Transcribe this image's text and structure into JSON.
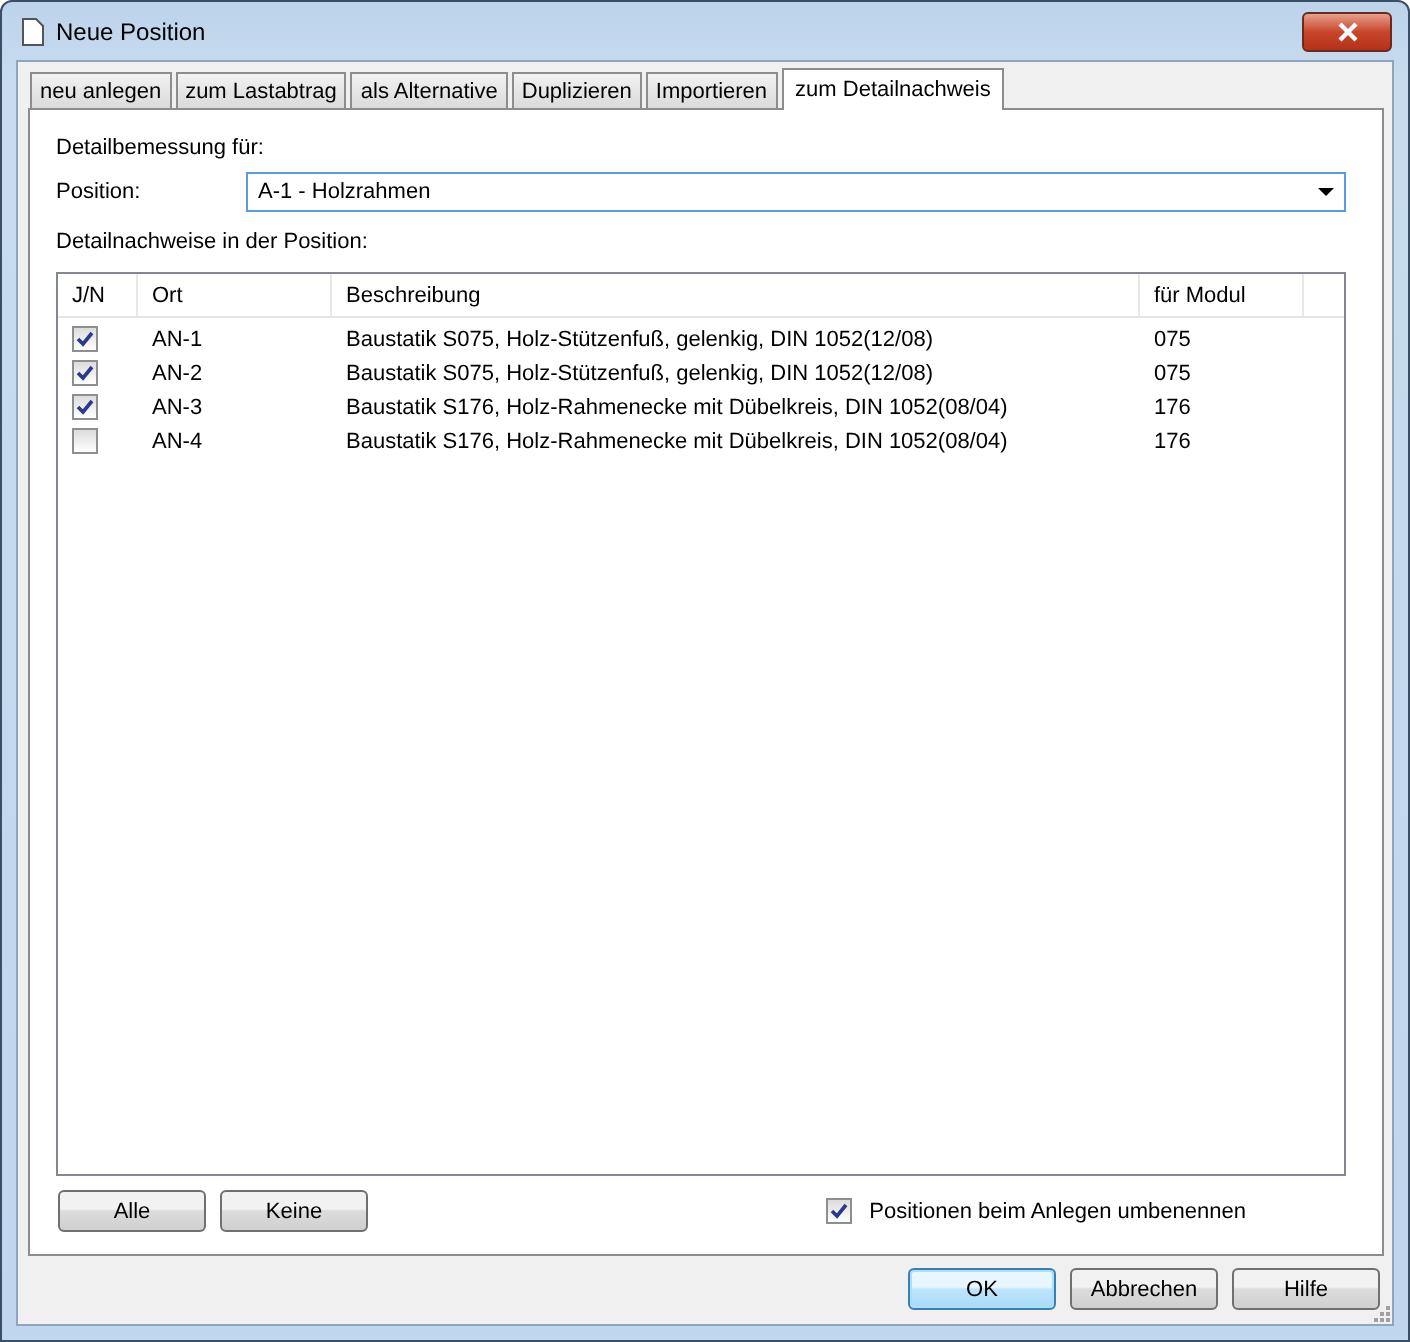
{
  "window": {
    "title": "Neue Position"
  },
  "tabs": [
    {
      "label": "neu anlegen",
      "selected": false
    },
    {
      "label": "zum Lastabtrag",
      "selected": false
    },
    {
      "label": "als Alternative",
      "selected": false
    },
    {
      "label": "Duplizieren",
      "selected": false
    },
    {
      "label": "Importieren",
      "selected": false
    },
    {
      "label": "zum Detailnachweis",
      "selected": true
    }
  ],
  "section_label": "Detailbemessung für:",
  "position": {
    "label": "Position:",
    "value": "A-1 - Holzrahmen"
  },
  "list_label": "Detailnachweise in der Position:",
  "table": {
    "columns": [
      "J/N",
      "Ort",
      "Beschreibung",
      "für Modul"
    ],
    "rows": [
      {
        "checked": true,
        "ort": "AN-1",
        "beschreibung": "Baustatik S075, Holz-Stützenfuß, gelenkig, DIN 1052(12/08)",
        "modul": "075"
      },
      {
        "checked": true,
        "ort": "AN-2",
        "beschreibung": "Baustatik S075, Holz-Stützenfuß, gelenkig, DIN 1052(12/08)",
        "modul": "075"
      },
      {
        "checked": true,
        "ort": "AN-3",
        "beschreibung": "Baustatik S176, Holz-Rahmenecke mit Dübelkreis, DIN 1052(08/04)",
        "modul": "176"
      },
      {
        "checked": false,
        "ort": "AN-4",
        "beschreibung": "Baustatik S176, Holz-Rahmenecke mit Dübelkreis, DIN 1052(08/04)",
        "modul": "176"
      }
    ]
  },
  "select_buttons": [
    "Alle",
    "Keine"
  ],
  "rename_option": {
    "label": "Positionen beim Anlegen umbenennen",
    "checked": true
  },
  "buttons": [
    {
      "label": "OK",
      "default": true
    },
    {
      "label": "Abbrechen",
      "default": false
    },
    {
      "label": "Hilfe",
      "default": false
    }
  ]
}
